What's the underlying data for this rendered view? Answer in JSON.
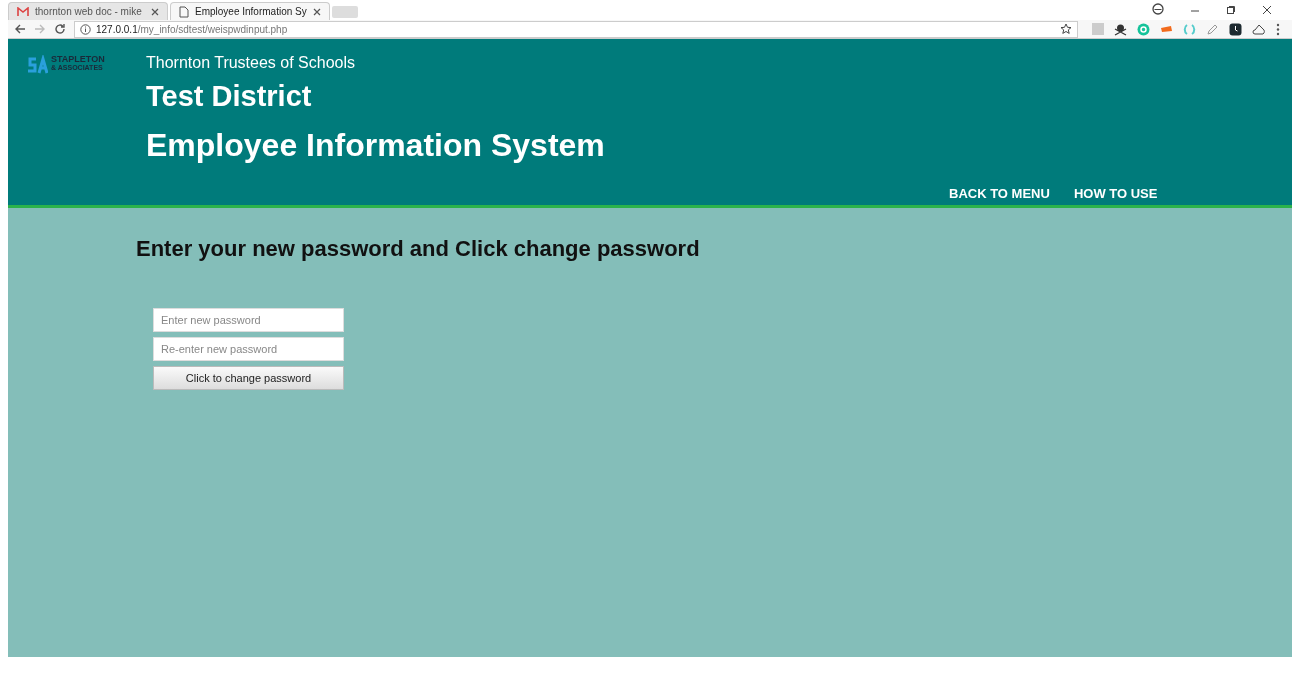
{
  "browser": {
    "tabs": [
      {
        "title": "thornton web doc - mike",
        "selected": false,
        "kind": "mail"
      },
      {
        "title": "Employee Information Sy",
        "selected": true,
        "kind": "page"
      }
    ],
    "url_host": "127.0.0.1",
    "url_path": "/my_info/sdtest/weispwdinput.php"
  },
  "header": {
    "logo_line1": "STAPLETON",
    "logo_line2": "& ASSOCIATES",
    "org": "Thornton Trustees of Schools",
    "district": "Test District",
    "system": "Employee Information System",
    "nav": [
      "BACK TO MENU",
      "HOW TO USE"
    ]
  },
  "main": {
    "heading": "Enter your new password and Click change password",
    "fields": [
      {
        "placeholder": "Enter new password"
      },
      {
        "placeholder": "Re-enter new password"
      }
    ],
    "button": "Click to change password"
  }
}
